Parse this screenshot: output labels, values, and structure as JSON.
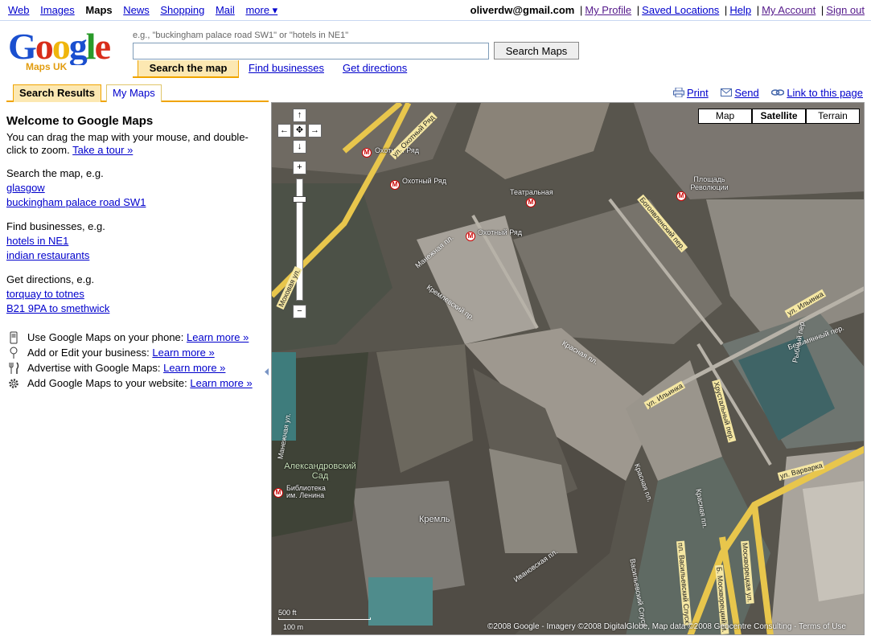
{
  "topbar": {
    "links": [
      "Web",
      "Images",
      "Maps",
      "News",
      "Shopping",
      "Mail"
    ],
    "current": "Maps",
    "more": "more ▾",
    "email": "oliverdw@gmail.com",
    "user_links": [
      "My Profile",
      "Saved Locations",
      "Help",
      "My Account",
      "Sign out"
    ]
  },
  "logo": {
    "wordmark": "Google",
    "subtitle": "Maps UK"
  },
  "search": {
    "hint": "e.g., \"buckingham palace road SW1\" or \"hotels in NE1\"",
    "value": "",
    "button": "Search Maps",
    "tabs": [
      "Search the map",
      "Find businesses",
      "Get directions"
    ]
  },
  "panel_tabs": [
    "Search Results",
    "My Maps"
  ],
  "map_links": [
    "Print",
    "Send",
    "Link to this page"
  ],
  "left": {
    "title": "Welcome to Google Maps",
    "intro": "You can drag the map with your mouse, and double-click to zoom.",
    "tour": "Take a tour »",
    "search_label": "Search the map, e.g.",
    "search_examples": [
      "glasgow",
      "buckingham palace road SW1"
    ],
    "business_label": "Find businesses, e.g.",
    "business_examples": [
      "hotels in NE1",
      "indian restaurants"
    ],
    "directions_label": "Get directions, e.g.",
    "directions_examples": [
      "torquay to totnes",
      "B21 9PA to smethwick"
    ],
    "features": [
      {
        "text": "Use Google Maps on your phone:",
        "link": "Learn more »",
        "icon": "phone-icon"
      },
      {
        "text": "Add or Edit your business:",
        "link": "Learn more »",
        "icon": "map-pin-icon"
      },
      {
        "text": "Advertise with Google Maps:",
        "link": "Learn more »",
        "icon": "fork-knife-icon"
      },
      {
        "text": "Add Google Maps to your website:",
        "link": "Learn more »",
        "icon": "gear-icon"
      }
    ]
  },
  "map": {
    "types": [
      "Map",
      "Satellite",
      "Terrain"
    ],
    "selected_type": "Satellite",
    "nav": {
      "up": "↑",
      "left": "←",
      "center": "✥",
      "right": "→",
      "down": "↓",
      "zoom_in": "+",
      "zoom_out": "−"
    },
    "labels": {
      "okhotny_ryad_1": "Охотный Ряд",
      "okhotny_ryad_2": "Охотный Ряд",
      "okhotny_ryad_3": "Охотный Ряд",
      "teatralnaya": "Театральная",
      "ploshchad_revolyutsii": "Площадь Революции",
      "alexandrovsky_sad": "Александровский Сад",
      "biblioteka": "Библиотека им. Ленина",
      "kreml": "Кремль"
    },
    "roads": {
      "okhotny": "ул. Охотный Ряд",
      "bogoyavlensky": "Богоявленский пер.",
      "ilyinka": "ул. Ильинка",
      "ilyinka2": "ул. Ильинка",
      "varvarka": "ул. Варварка",
      "khrustalny": "Хрустальный пер.",
      "krasnaya1": "Красная пл.",
      "krasnaya2": "Красная пл.",
      "krasnaya3": "Красная пл.",
      "manezhnaya": "Манежная пл.",
      "kremlevsky": "Кремлевский пр.",
      "ivanovskaya": "Ивановская пл.",
      "mokhovaya": "Моховая ул.",
      "manezhnaya_ul": "Манежная ул.",
      "vasilyevsky": "пл. Васильевский Спуск",
      "b_moskvoretsky": "Б. Москворецкий м.",
      "moskvoretskaya": "Москворецкая ул.",
      "bezymyanny": "Безымянный пер.",
      "rybny": "Рыбный пер.",
      "vasilyevsky_spusk": "Васильевский Спуск"
    },
    "scale_ft": "500 ft",
    "scale_m": "100 m",
    "copyright": "©2008 Google - Imagery ©2008 DigitalGlobe, Map data ©2008 Geocentre Consulting - Terms of Use"
  },
  "colors": {
    "link": "#0000cc",
    "visited": "#551a8b",
    "tab_active": "#fce8b2",
    "tab_border": "#f0a400",
    "road": "#f5e7a3"
  }
}
